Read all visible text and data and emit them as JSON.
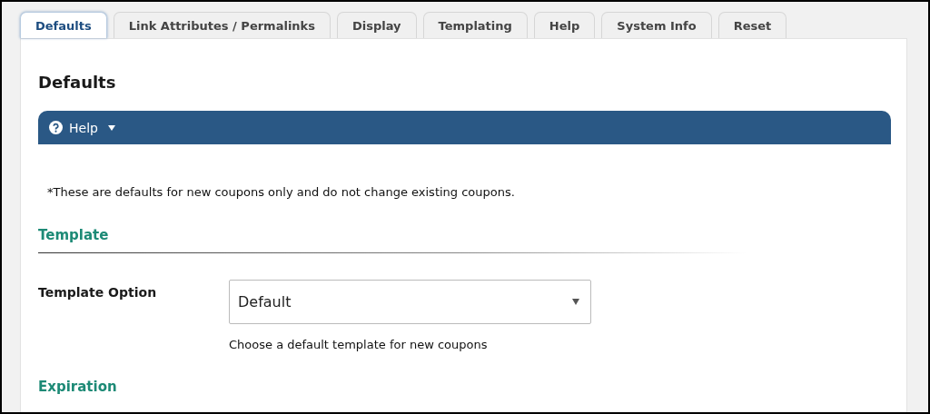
{
  "tabs": [
    {
      "label": "Defaults",
      "selected": true
    },
    {
      "label": "Link Attributes / Permalinks",
      "selected": false
    },
    {
      "label": "Display",
      "selected": false
    },
    {
      "label": "Templating",
      "selected": false
    },
    {
      "label": "Help",
      "selected": false
    },
    {
      "label": "System Info",
      "selected": false
    },
    {
      "label": "Reset",
      "selected": false
    }
  ],
  "page_title": "Defaults",
  "help_bar": {
    "label": "Help",
    "expanded": false
  },
  "note": "*These are defaults for new coupons only and do not change existing coupons.",
  "sections": [
    {
      "title": "Template",
      "fields": [
        {
          "label": "Template Option",
          "value": "Default",
          "hint": "Choose a default template for new coupons"
        }
      ]
    },
    {
      "title": "Expiration"
    }
  ]
}
